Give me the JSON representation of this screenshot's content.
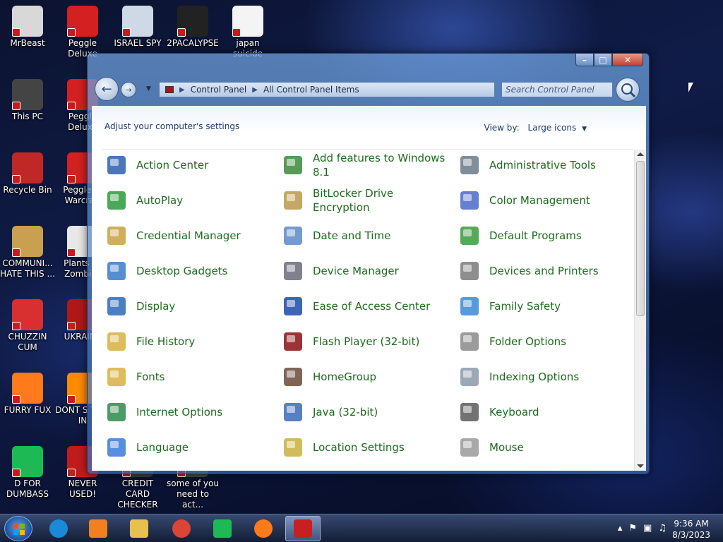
{
  "desktop": {
    "icons": [
      {
        "label": "MrBeast",
        "icon": "mrbeast-icon",
        "color": "#d8d8d8"
      },
      {
        "label": "Peggle Deluxe",
        "icon": "peggle-icon",
        "color": "#d42020"
      },
      {
        "label": "ISRAEL SPY",
        "icon": "network-icon",
        "color": "#cfd8e6"
      },
      {
        "label": "2PACALYPSE",
        "icon": "console-icon",
        "color": "#222222"
      },
      {
        "label": "japan suicide",
        "icon": "batch-file-icon",
        "color": "#f4f4f4"
      },
      {
        "label": "This PC",
        "icon": "computer-icon",
        "color": "#444444"
      },
      {
        "label": "Peggle Deluxe",
        "icon": "peggle-icon",
        "color": "#d42020"
      },
      {
        "label": "Recycle Bin",
        "icon": "recycle-bin-icon",
        "color": "#c02828"
      },
      {
        "label": "Peggle of Warcraft",
        "icon": "peggle-icon",
        "color": "#d42020"
      },
      {
        "label": "COMMUNI... HATE THIS ...",
        "icon": "money-bag-icon",
        "color": "#c8a050"
      },
      {
        "label": "Plants vs Zombies",
        "icon": "flower-icon",
        "color": "#e8e8e8"
      },
      {
        "label": "CHUZZIN CUM",
        "icon": "chuzzle-icon",
        "color": "#d83030"
      },
      {
        "label": "UKRAINE",
        "icon": "radiation-icon",
        "color": "#b01818"
      },
      {
        "label": "FURRY FUX",
        "icon": "firefox-icon",
        "color": "#ff7a1a"
      },
      {
        "label": "DONT S THIS IN",
        "icon": "vlc-icon",
        "color": "#ff8a00"
      },
      {
        "label": "D FOR DUMBASS",
        "icon": "spotify-like-icon",
        "color": "#1db954"
      },
      {
        "label": "NEVER USED!",
        "icon": "dell-icon",
        "color": "#c01c1c"
      },
      {
        "label": "CREDIT CARD CHECKER",
        "icon": "card-icon",
        "color": "#3a3a3a"
      },
      {
        "label": "some of you need to act...",
        "icon": "file-icon",
        "color": "#444444"
      }
    ]
  },
  "window": {
    "controls": {
      "minimize": "–",
      "maximize": "□",
      "close": "✕"
    },
    "address": {
      "root": "Control Panel",
      "current": "All Control Panel Items"
    },
    "search_placeholder": "Search Control Panel",
    "subtitle": "Adjust your computer's settings",
    "view_by_label": "View by:",
    "view_by_value": "Large icons",
    "items": [
      {
        "label": "Action Center",
        "icon": "flag-icon",
        "color": "#2a5fb0"
      },
      {
        "label": "Add features to Windows 8.1",
        "icon": "add-features-icon",
        "color": "#3a8a3a"
      },
      {
        "label": "Administrative Tools",
        "icon": "admin-tools-icon",
        "color": "#6a7a8a"
      },
      {
        "label": "AutoPlay",
        "icon": "autoplay-icon",
        "color": "#2a9a3a"
      },
      {
        "label": "BitLocker Drive Encryption",
        "icon": "key-icon",
        "color": "#b89a4a"
      },
      {
        "label": "Color Management",
        "icon": "color-management-icon",
        "color": "#4a6ac8"
      },
      {
        "label": "Credential Manager",
        "icon": "vault-icon",
        "color": "#c8a040"
      },
      {
        "label": "Date and Time",
        "icon": "calendar-clock-icon",
        "color": "#5a8ac8"
      },
      {
        "label": "Default Programs",
        "icon": "default-programs-icon",
        "color": "#3a9a3a"
      },
      {
        "label": "Desktop Gadgets",
        "icon": "gadgets-icon",
        "color": "#3a7ac8"
      },
      {
        "label": "Device Manager",
        "icon": "device-manager-icon",
        "color": "#6a6a7a"
      },
      {
        "label": "Devices and Printers",
        "icon": "printer-icon",
        "color": "#7a7a7a"
      },
      {
        "label": "Display",
        "icon": "monitor-icon",
        "color": "#2a6ab8"
      },
      {
        "label": "Ease of Access Center",
        "icon": "ease-of-access-icon",
        "color": "#1a4aa8"
      },
      {
        "label": "Family Safety",
        "icon": "family-icon",
        "color": "#3a8ad8"
      },
      {
        "label": "File History",
        "icon": "file-history-icon",
        "color": "#d8b040"
      },
      {
        "label": "Flash Player (32-bit)",
        "icon": "flash-icon",
        "color": "#8a1010"
      },
      {
        "label": "Folder Options",
        "icon": "folder-options-icon",
        "color": "#8a8a8a"
      },
      {
        "label": "Fonts",
        "icon": "fonts-icon",
        "color": "#d8b040"
      },
      {
        "label": "HomeGroup",
        "icon": "home-icon",
        "color": "#6a4a3a"
      },
      {
        "label": "Indexing Options",
        "icon": "indexing-icon",
        "color": "#8a9aaa"
      },
      {
        "label": "Internet Options",
        "icon": "globe-icon",
        "color": "#2a8a4a"
      },
      {
        "label": "Java (32-bit)",
        "icon": "java-icon",
        "color": "#3a6ab8"
      },
      {
        "label": "Keyboard",
        "icon": "keyboard-icon",
        "color": "#5a5a5a"
      },
      {
        "label": "Language",
        "icon": "language-icon",
        "color": "#3a7ad8"
      },
      {
        "label": "Location Settings",
        "icon": "location-icon",
        "color": "#c8b040"
      },
      {
        "label": "Mouse",
        "icon": "mouse-icon",
        "color": "#9a9a9a"
      }
    ]
  },
  "taskbar": {
    "pinned": [
      {
        "icon": "internet-explorer-icon",
        "color": "#1a8ad8"
      },
      {
        "icon": "media-player-icon",
        "color": "#f08020"
      },
      {
        "icon": "file-explorer-icon",
        "color": "#e8c050"
      },
      {
        "icon": "chrome-icon",
        "color": "#db4437"
      },
      {
        "icon": "green-app-icon",
        "color": "#1db954"
      },
      {
        "icon": "firefox-icon",
        "color": "#ff7a1a"
      },
      {
        "icon": "control-panel-icon",
        "color": "#c82020"
      }
    ],
    "tray": {
      "chevron": "▴",
      "flag": "⚑",
      "network": "▣",
      "volume": "♫"
    },
    "time": "9:36 AM",
    "date": "8/3/2023"
  }
}
